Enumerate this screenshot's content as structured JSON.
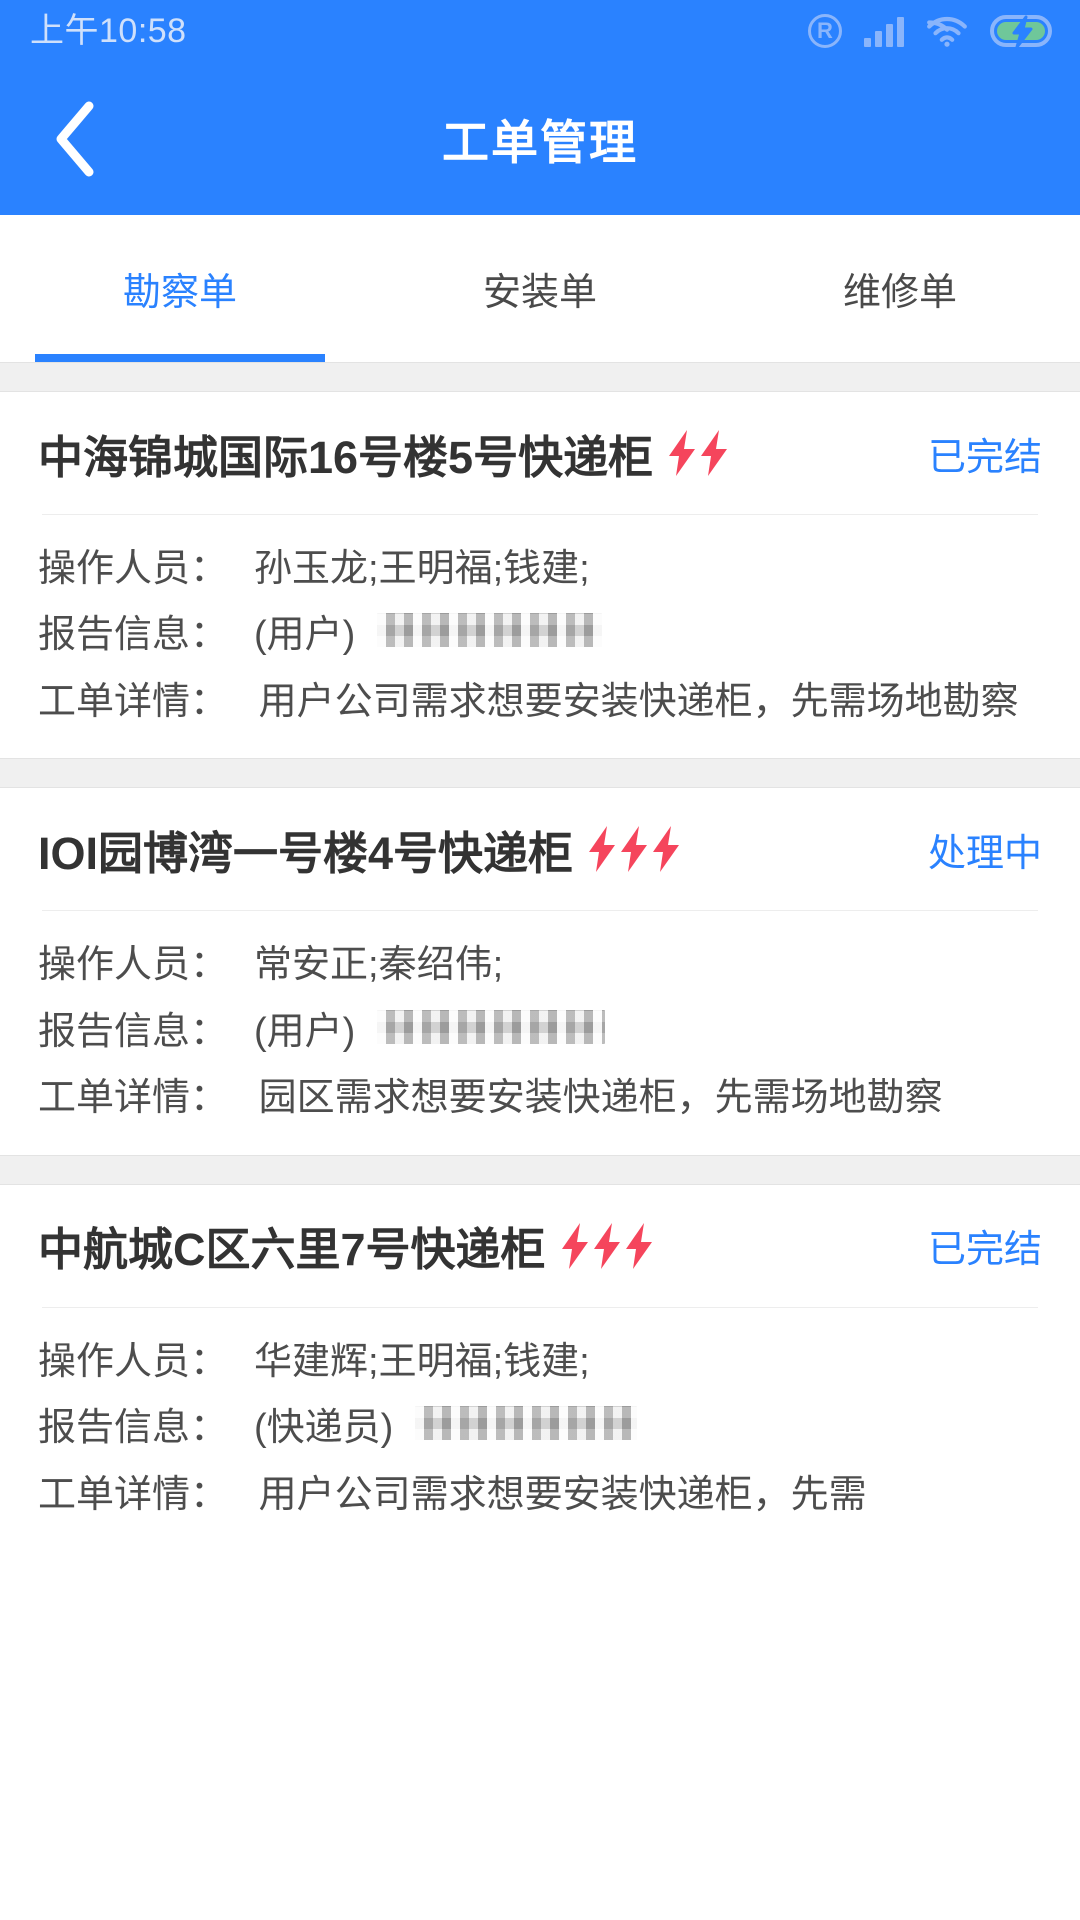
{
  "status_bar": {
    "time": "上午10:58",
    "icons": [
      "registered-icon",
      "signal-icon",
      "wifi-icon",
      "battery-charging-icon"
    ],
    "battery_color": "#6fc79a"
  },
  "app_bar": {
    "title": "工单管理",
    "back_icon": "chevron-left-icon",
    "background": "#2a82ff"
  },
  "tabs": {
    "active_index": 0,
    "items": [
      {
        "label": "勘察单"
      },
      {
        "label": "安装单"
      },
      {
        "label": "维修单"
      }
    ],
    "active_color": "#2a82ff",
    "inactive_color": "#4a4a4a"
  },
  "labels": {
    "operator": "操作人员：",
    "report": "报告信息：",
    "detail": "工单详情："
  },
  "colors": {
    "bolt": "#f5455c",
    "status": "#2a82ff",
    "divider": "#ededed",
    "gap": "#f0f0f0"
  },
  "orders": [
    {
      "title": "中海锦城国际16号楼5号快递柜",
      "priority_bolts": 2,
      "status": "已完结",
      "operator": "孙玉龙;王明福;钱建;",
      "report_role": "(用户)",
      "report_redacted_width": 225,
      "detail": "用户公司需求想要安装快递柜，先需场地勘察"
    },
    {
      "title": "IOI园博湾一号楼4号快递柜",
      "priority_bolts": 3,
      "status": "处理中",
      "operator": "常安正;秦绍伟;",
      "report_role": "(用户)",
      "report_redacted_width": 228,
      "detail": "园区需求想要安装快递柜，先需场地勘察"
    },
    {
      "title": "中航城C区六里7号快递柜",
      "priority_bolts": 3,
      "status": "已完结",
      "operator": "华建辉;王明福;钱建;",
      "report_role": "(快递员)",
      "report_redacted_width": 222,
      "detail": "用户公司需求想要安装快递柜，先需"
    }
  ]
}
